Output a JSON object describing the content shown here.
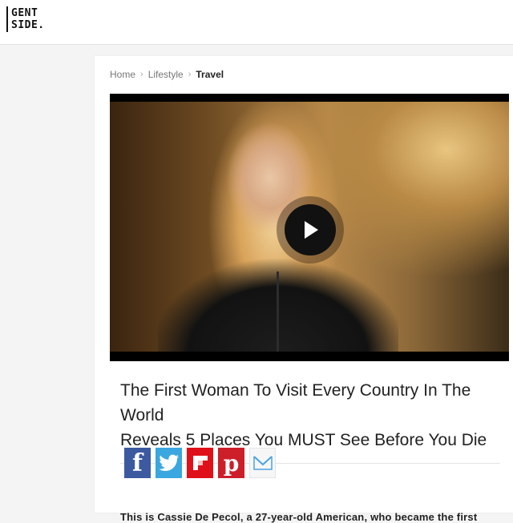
{
  "logo": {
    "line1": "GENT",
    "line2": "SIDE."
  },
  "breadcrumb": {
    "items": [
      {
        "label": "Home"
      },
      {
        "label": "Lifestyle"
      },
      {
        "label": "Travel"
      }
    ],
    "separator": ">"
  },
  "video": {
    "play_icon": "play-icon"
  },
  "article": {
    "title_line1": "The First Woman To Visit Every Country In The World",
    "title_line2": "Reveals 5 Places You MUST See Before You Die",
    "intro": "This is Cassie De Pecol, a 27-year-old American, who became the first"
  },
  "share": {
    "buttons": [
      {
        "icon": "facebook-icon",
        "label": "f",
        "color": "#3b5aa0"
      },
      {
        "icon": "twitter-icon",
        "color": "#3aa7e0"
      },
      {
        "icon": "flipboard-icon",
        "color": "#e0101a"
      },
      {
        "icon": "pinterest-icon",
        "label": "p",
        "color": "#cc1f2a"
      },
      {
        "icon": "email-icon",
        "color": "#f6f6f6"
      }
    ]
  }
}
